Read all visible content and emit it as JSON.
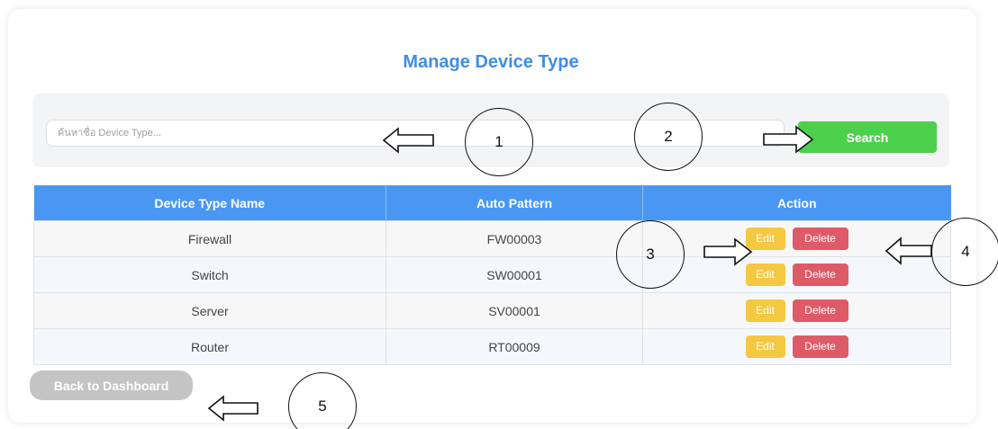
{
  "page": {
    "title": "Manage Device Type"
  },
  "search": {
    "placeholder": "ค้นหาชื่อ Device Type...",
    "button_label": "Search"
  },
  "table": {
    "headers": [
      "Device Type Name",
      "Auto Pattern",
      "Action"
    ],
    "rows": [
      {
        "name": "Firewall",
        "pattern": "FW00003"
      },
      {
        "name": "Switch",
        "pattern": "SW00001"
      },
      {
        "name": "Server",
        "pattern": "SV00001"
      },
      {
        "name": "Router",
        "pattern": "RT00009"
      }
    ],
    "edit_label": "Edit",
    "delete_label": "Delete"
  },
  "footer": {
    "back_label": "Back to Dashboard"
  },
  "callouts": [
    "1",
    "2",
    "3",
    "4",
    "5"
  ],
  "colors": {
    "title": "#3f8de6",
    "header_bg": "#4a97f3",
    "search_button": "#4cd04c",
    "edit_button": "#f5c842",
    "delete_button": "#de5a67",
    "back_button": "#c4c4c4"
  }
}
